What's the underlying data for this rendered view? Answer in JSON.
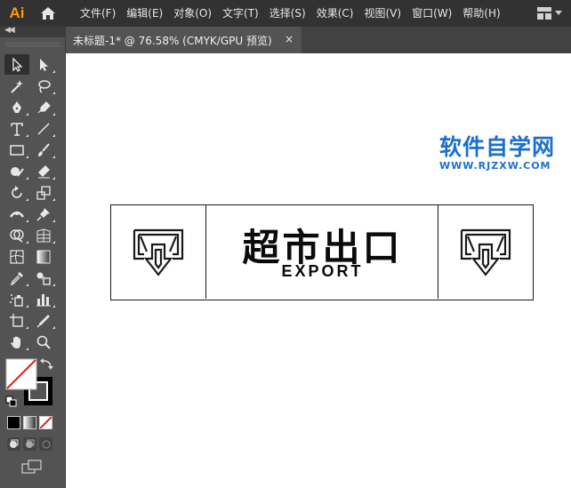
{
  "app": {
    "logo_text": "Ai"
  },
  "menu": {
    "items": [
      "文件(F)",
      "编辑(E)",
      "对象(O)",
      "文字(T)",
      "选择(S)",
      "效果(C)",
      "视图(V)",
      "窗口(W)",
      "帮助(H)"
    ]
  },
  "document": {
    "tab_label": "未标题-1* @ 76.58% (CMYK/GPU 预览)",
    "close_glyph": "×"
  },
  "watermark": {
    "title": "软件自学网",
    "url": "WWW.RJZXW.COM"
  },
  "sign": {
    "title": "超市出口",
    "subtitle": "EXPORT"
  },
  "colors": {
    "menubar": "#323232",
    "panel": "#535353",
    "ai_orange": "#ff9a00",
    "watermark_blue": "#1a6fd0"
  },
  "tools": [
    [
      "selection-tool",
      "direct-selection-tool"
    ],
    [
      "magic-wand-tool",
      "lasso-tool"
    ],
    [
      "pen-tool",
      "curvature-tool"
    ],
    [
      "type-tool",
      "line-segment-tool"
    ],
    [
      "rectangle-tool",
      "paintbrush-tool"
    ],
    [
      "shaper-tool",
      "eraser-tool"
    ],
    [
      "rotate-tool",
      "scale-tool"
    ],
    [
      "width-tool",
      "puppet-warp-tool"
    ],
    [
      "shape-builder-tool",
      "perspective-grid-tool"
    ],
    [
      "mesh-tool",
      "gradient-tool"
    ],
    [
      "eyedropper-tool",
      "blend-tool"
    ],
    [
      "symbol-sprayer-tool",
      "column-graph-tool"
    ],
    [
      "artboard-tool",
      "slice-tool"
    ],
    [
      "hand-tool",
      "zoom-tool"
    ]
  ]
}
